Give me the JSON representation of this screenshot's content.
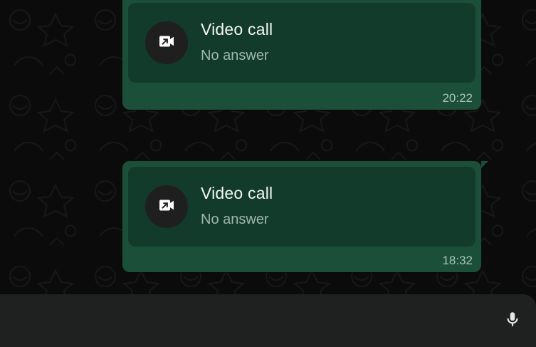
{
  "theme": {
    "bubble_bg": "#1b4f3a",
    "card_bg": "#123b2b",
    "composer_bg": "#1f2121"
  },
  "messages": [
    {
      "title": "Video call",
      "subtitle": "No answer",
      "time": "20:22",
      "icon": "video-call-outgoing-icon"
    },
    {
      "title": "Video call",
      "subtitle": "No answer",
      "time": "18:32",
      "icon": "video-call-outgoing-icon"
    }
  ],
  "composer": {
    "mic_icon": "microphone-icon"
  }
}
